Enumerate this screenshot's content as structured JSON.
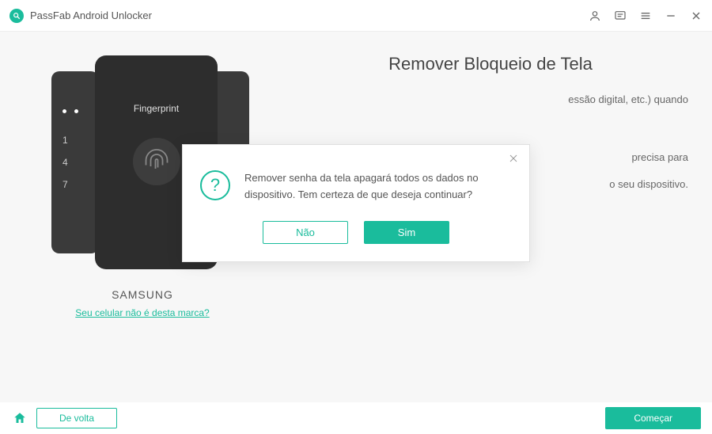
{
  "app": {
    "title": "PassFab Android Unlocker"
  },
  "phone": {
    "fingerprint_label": "Fingerprint",
    "keypad": [
      "1",
      "4",
      "7"
    ]
  },
  "device": {
    "brand": "SAMSUNG",
    "change_link": "Seu celular não é desta marca?"
  },
  "page": {
    "heading": "Remover Bloqueio de Tela",
    "line_partial_1": "essão digital, etc.) quando",
    "line_partial_2": "precisa para",
    "line_partial_3": "o seu dispositivo."
  },
  "modal": {
    "message": "Remover senha da tela apagará todos os dados no dispositivo. Tem certeza de que deseja continuar?",
    "no_label": "Não",
    "yes_label": "Sim"
  },
  "footer": {
    "back_label": "De volta",
    "start_label": "Começar"
  }
}
